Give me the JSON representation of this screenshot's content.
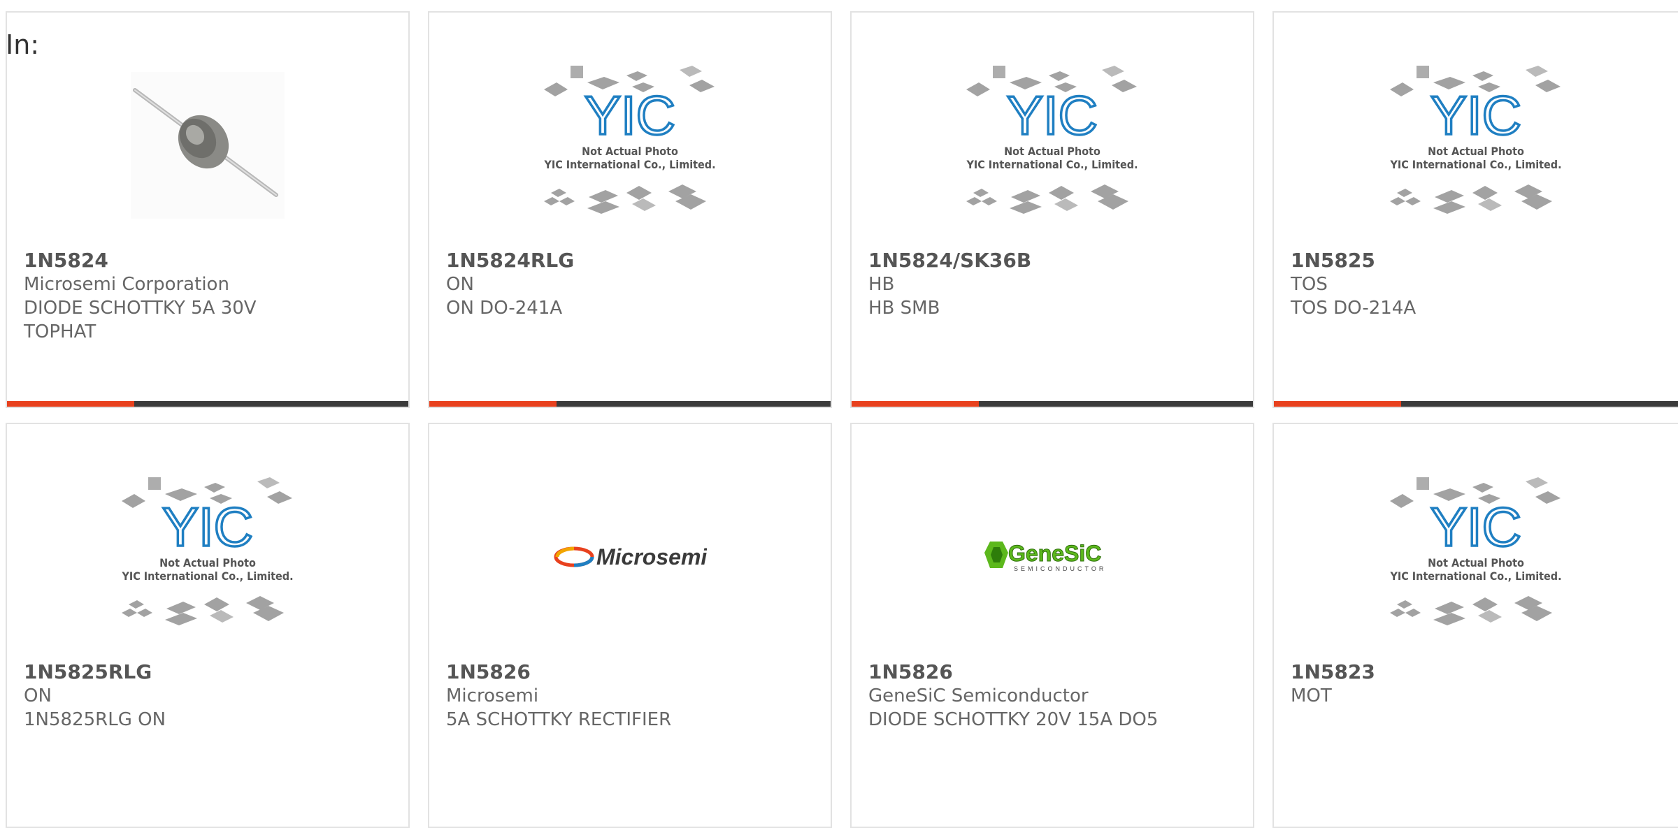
{
  "page": {
    "label": "In:"
  },
  "placeholder": {
    "logo_text": "YIC",
    "line1": "Not Actual Photo",
    "line2": "YIC International Co., Limited."
  },
  "cards": [
    {
      "part": "1N5824",
      "maker": "Microsemi Corporation",
      "desc": "DIODE SCHOTTKY 5A 30V",
      "desc2": "TOPHAT",
      "image": "diode-photo"
    },
    {
      "part": "1N5824RLG",
      "maker": "ON",
      "desc": "ON DO-241A",
      "desc2": "",
      "image": "yic-placeholder"
    },
    {
      "part": "1N5824/SK36B",
      "maker": "HB",
      "desc": "HB SMB",
      "desc2": "",
      "image": "yic-placeholder"
    },
    {
      "part": "1N5825",
      "maker": "TOS",
      "desc": "TOS DO-214A",
      "desc2": "",
      "image": "yic-placeholder"
    },
    {
      "part": "1N5825RLG",
      "maker": "ON",
      "desc": "1N5825RLG ON",
      "desc2": "",
      "image": "yic-placeholder"
    },
    {
      "part": "1N5826",
      "maker": "Microsemi",
      "desc": "5A SCHOTTKY RECTIFIER",
      "desc2": "",
      "image": "microsemi-logo",
      "logo_text": "Microsemi"
    },
    {
      "part": "1N5826",
      "maker": "GeneSiC Semiconductor",
      "desc": "DIODE SCHOTTKY 20V 15A DO5",
      "desc2": "",
      "image": "genesic-logo",
      "logo_text": "GeneSiC",
      "logo_sub": "SEMICONDUCTOR"
    },
    {
      "part": "1N5823",
      "maker": "MOT",
      "desc": "",
      "desc2": "",
      "image": "yic-placeholder"
    }
  ],
  "colors": {
    "accent": "#e8411e",
    "bar": "#3b3b3b",
    "yic_blue": "#1f7fc2",
    "genesic_green": "#5cb81c"
  }
}
